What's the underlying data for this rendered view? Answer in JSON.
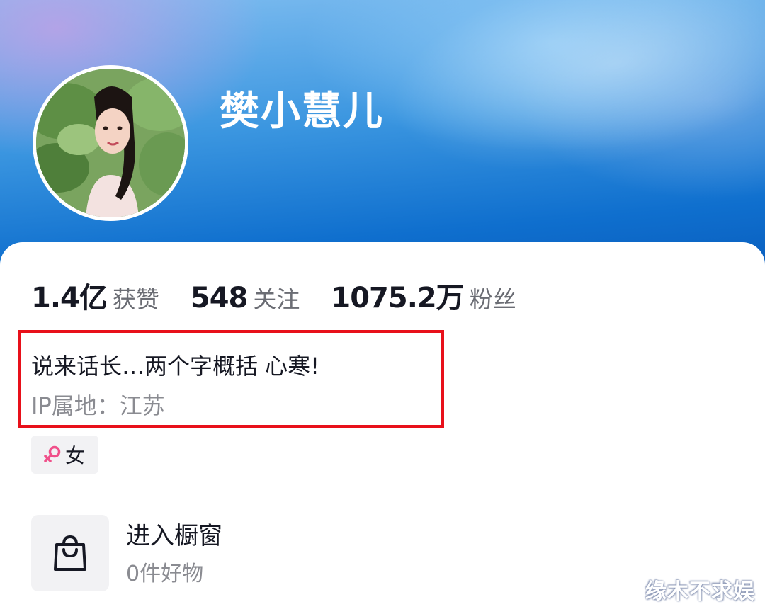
{
  "profile": {
    "username": "樊小慧儿",
    "avatar": "avatar-photo"
  },
  "stats": [
    {
      "value": "1.4亿",
      "label": "获赞"
    },
    {
      "value": "548",
      "label": "关注"
    },
    {
      "value": "1075.2万",
      "label": "粉丝"
    }
  ],
  "bio": {
    "text": "说来话长…两个字概括 心寒!",
    "ip": "IP属地：江苏"
  },
  "gender_tag": {
    "icon": "female-icon",
    "label": "女"
  },
  "shop": {
    "icon": "shopping-bag-icon",
    "title": "进入橱窗",
    "subtitle": "0件好物"
  },
  "watermark": "缘木不求娱",
  "colors": {
    "highlight_border": "#e8101a",
    "female_icon": "#f0508a"
  }
}
